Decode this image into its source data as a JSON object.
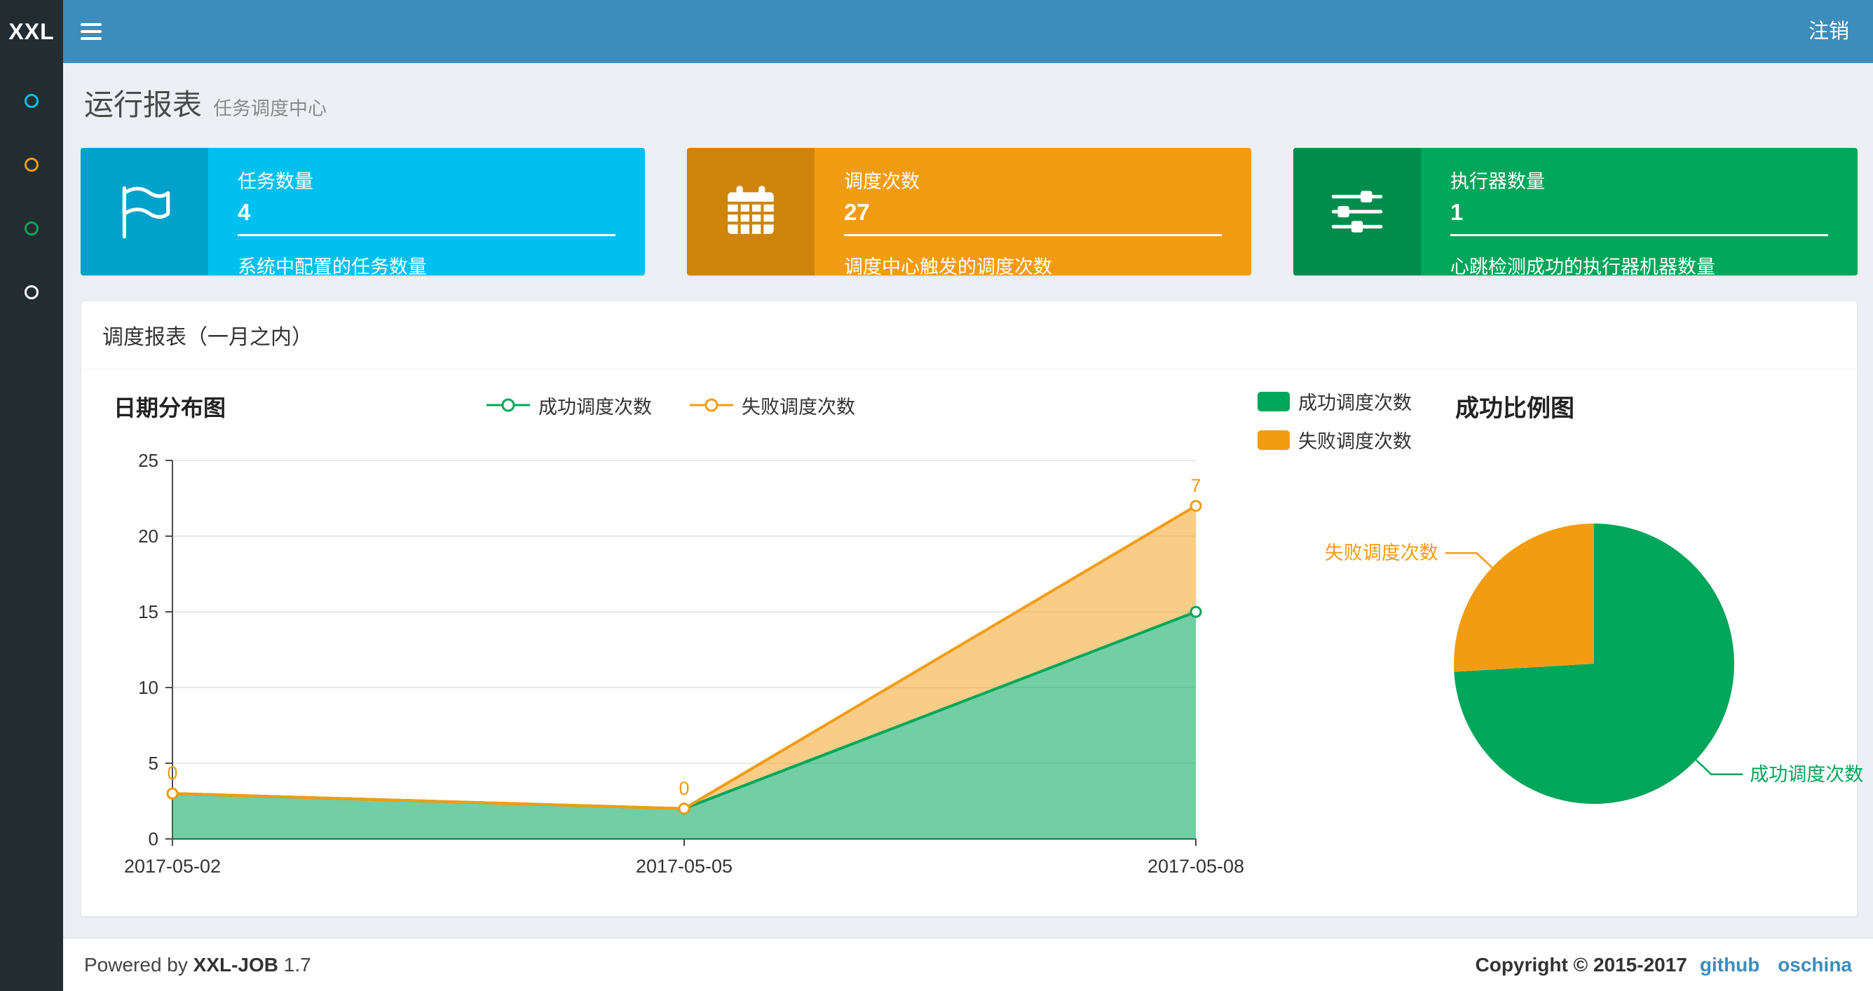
{
  "theme": {
    "navbar_bg": "#3c8dbc",
    "logo_bg": "#222d32",
    "sidebar_bg": "#222d32",
    "content_bg": "#ecf0f5",
    "link_color": "#3c8dbc"
  },
  "navbar": {
    "logo_text": "XXL",
    "logout_label": "注销"
  },
  "sidebar": {
    "items": [
      {
        "name": "menu-dot-report",
        "color": "#00c0ef"
      },
      {
        "name": "menu-dot-jobs",
        "color": "#f39c12"
      },
      {
        "name": "menu-dot-log",
        "color": "#00a65a"
      },
      {
        "name": "menu-dot-executor",
        "color": "#ffffff"
      }
    ]
  },
  "page_header": {
    "title": "运行报表",
    "subtitle": "任务调度中心"
  },
  "info_boxes": [
    {
      "icon": "flag-icon",
      "label": "任务数量",
      "value": "4",
      "desc": "系统中配置的任务数量",
      "color": "#00c0ef",
      "icon_bg": "#00a2cc"
    },
    {
      "icon": "calendar-icon",
      "label": "调度次数",
      "value": "27",
      "desc": "调度中心触发的调度次数",
      "color": "#f39c12",
      "icon_bg": "#cf840b"
    },
    {
      "icon": "sliders-icon",
      "label": "执行器数量",
      "value": "1",
      "desc": "心跳检测成功的执行器机器数量",
      "color": "#00a65a",
      "icon_bg": "#008d4c"
    }
  ],
  "panel": {
    "title": "调度报表（一月之内）"
  },
  "chart_data": [
    {
      "type": "area",
      "title": "日期分布图",
      "x": [
        "2017-05-02",
        "2017-05-05",
        "2017-05-08"
      ],
      "ylim": [
        0,
        25
      ],
      "yticks": [
        0,
        5,
        10,
        15,
        20,
        25
      ],
      "stacked": true,
      "grid": true,
      "legend_position": "top-center",
      "series": [
        {
          "name": "成功调度次数",
          "values": [
            3,
            2,
            15
          ],
          "color": "#00A65A",
          "fill_opacity": 0.55
        },
        {
          "name": "失败调度次数",
          "values": [
            0,
            0,
            7
          ],
          "color": "#F39C12",
          "fill_opacity": 0.5,
          "point_labels": [
            "0",
            "0",
            "7"
          ]
        }
      ]
    },
    {
      "type": "pie",
      "title": "成功比例图",
      "legend_position": "top-left",
      "slices": [
        {
          "name": "成功调度次数",
          "value": 20,
          "color": "#00A65A"
        },
        {
          "name": "失败调度次数",
          "value": 7,
          "color": "#F39C12"
        }
      ]
    }
  ],
  "footer": {
    "powered_by": "Powered by",
    "product": "XXL-JOB",
    "version": "1.7",
    "copyright": "Copyright © 2015-2017",
    "links": [
      {
        "label": "github"
      },
      {
        "label": "oschina"
      }
    ]
  }
}
